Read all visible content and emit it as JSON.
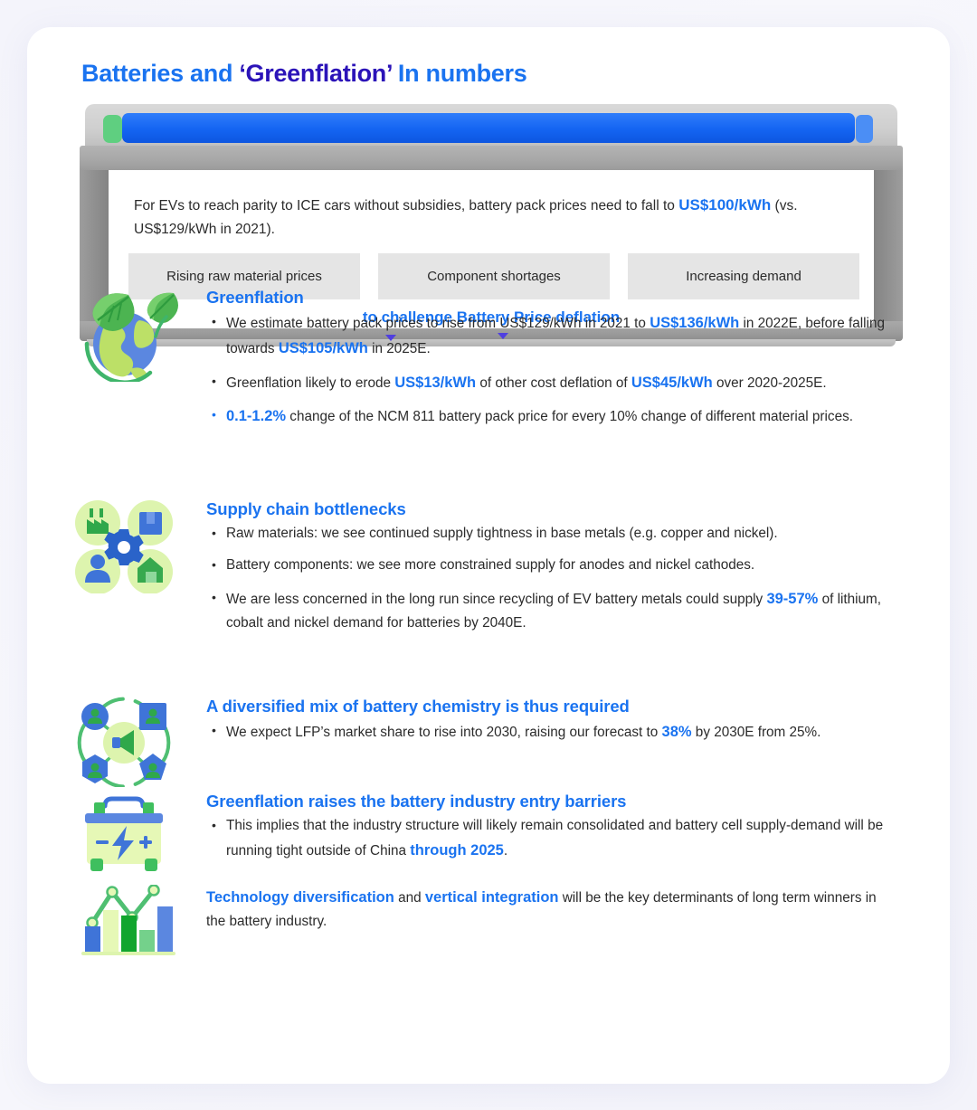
{
  "title": {
    "part1": "Batteries and ",
    "part2": "‘Greenflation’",
    "part3": " In numbers"
  },
  "colors": {
    "accent_blue": "#1a73f0",
    "title_navy": "#2b13b8",
    "body_text": "#2b2b2b",
    "box_gray": "#e5e5e5",
    "battery_casing": "#9d9d9d",
    "icon_green": "#22a93f",
    "icon_light_green": "#d9f5a8",
    "icon_blue": "#4b7fe8"
  },
  "battery_panel": {
    "lead_pre": "For EVs to reach parity to ICE cars without subsidies, battery pack prices need to fall to ",
    "lead_highlight": "US$100/kWh",
    "lead_post": " (vs. US$129/kWh in 2021).",
    "drivers": [
      "Rising raw material prices",
      "Component shortages",
      "Increasing demand"
    ],
    "footer": "to challenge Battery Price deflation"
  },
  "sections": [
    {
      "icon": "globe-leaf-icon",
      "heading": "Greenflation",
      "bullets": [
        {
          "blue_bullet": false,
          "parts": [
            {
              "t": "We estimate battery pack prices to rise from US$129/kWh in 2021 to ",
              "hl": false
            },
            {
              "t": "US$136/kWh",
              "hl": true
            },
            {
              "t": " in 2022E, before falling towards ",
              "hl": false
            },
            {
              "t": "US$105/kWh",
              "hl": true
            },
            {
              "t": " in 2025E.",
              "hl": false
            }
          ]
        },
        {
          "blue_bullet": false,
          "parts": [
            {
              "t": "Greenflation likely to erode ",
              "hl": false
            },
            {
              "t": "US$13/kWh",
              "hl": true
            },
            {
              "t": " of other cost deflation of ",
              "hl": false
            },
            {
              "t": "US$45/kWh",
              "hl": true
            },
            {
              "t": " over 2020-2025E.",
              "hl": false
            }
          ]
        },
        {
          "blue_bullet": true,
          "parts": [
            {
              "t": "0.1-1.2%",
              "hl": true
            },
            {
              "t": " change of the NCM 811 battery pack price for every 10% change of different material prices.",
              "hl": false
            }
          ]
        }
      ]
    },
    {
      "icon": "supply-chain-icon",
      "heading": "Supply chain bottlenecks",
      "bullets": [
        {
          "blue_bullet": false,
          "parts": [
            {
              "t": "Raw materials: we see continued supply tightness in base metals (e.g. copper and nickel).",
              "hl": false
            }
          ]
        },
        {
          "blue_bullet": false,
          "parts": [
            {
              "t": "Battery components: we see more constrained supply for anodes and nickel cathodes.",
              "hl": false
            }
          ]
        },
        {
          "blue_bullet": false,
          "parts": [
            {
              "t": "We are less concerned in the long run since recycling of EV battery metals could supply ",
              "hl": false
            },
            {
              "t": "39-57%",
              "hl": true
            },
            {
              "t": " of lithium, cobalt and nickel demand for batteries by 2040E.",
              "hl": false
            }
          ]
        }
      ]
    },
    {
      "icon": "network-diversification-icon",
      "heading": "A diversified mix of battery chemistry is thus required",
      "bullets": [
        {
          "blue_bullet": false,
          "parts": [
            {
              "t": "We expect LFP’s market share to rise into 2030, raising our forecast to ",
              "hl": false
            },
            {
              "t": "38%",
              "hl": true
            },
            {
              "t": " by 2030E from 25%.",
              "hl": false
            }
          ]
        }
      ]
    },
    {
      "icon": "battery-icon",
      "heading": "Greenflation raises the battery industry entry barriers",
      "bullets": [
        {
          "blue_bullet": false,
          "parts": [
            {
              "t": "This implies that the industry structure will likely remain consolidated and battery cell supply-demand will be running tight outside of China ",
              "hl": false
            },
            {
              "t": "through 2025",
              "hl": true
            },
            {
              "t": ".",
              "hl": false
            }
          ]
        }
      ]
    },
    {
      "icon": "bar-chart-icon",
      "heading": "",
      "plain": [
        {
          "t": "Technology diversification",
          "hl": true
        },
        {
          "t": " and ",
          "hl": false
        },
        {
          "t": "vertical integration",
          "hl": true
        },
        {
          "t": " will be the key determinants of long term winners in the battery industry.",
          "hl": false
        }
      ]
    }
  ]
}
